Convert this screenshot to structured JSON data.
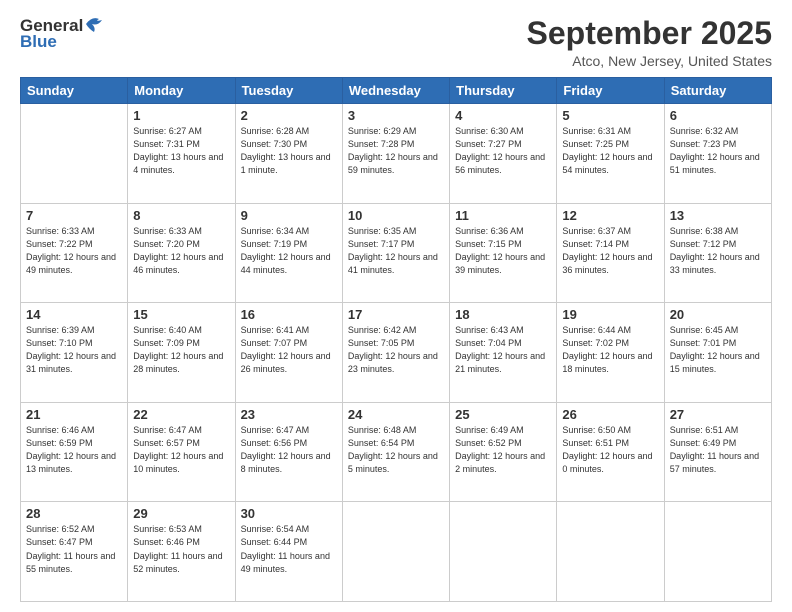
{
  "header": {
    "logo_general": "General",
    "logo_blue": "Blue",
    "title": "September 2025",
    "subtitle": "Atco, New Jersey, United States"
  },
  "calendar": {
    "days_of_week": [
      "Sunday",
      "Monday",
      "Tuesday",
      "Wednesday",
      "Thursday",
      "Friday",
      "Saturday"
    ],
    "weeks": [
      [
        {
          "day": "",
          "sunrise": "",
          "sunset": "",
          "daylight": ""
        },
        {
          "day": "1",
          "sunrise": "Sunrise: 6:27 AM",
          "sunset": "Sunset: 7:31 PM",
          "daylight": "Daylight: 13 hours and 4 minutes."
        },
        {
          "day": "2",
          "sunrise": "Sunrise: 6:28 AM",
          "sunset": "Sunset: 7:30 PM",
          "daylight": "Daylight: 13 hours and 1 minute."
        },
        {
          "day": "3",
          "sunrise": "Sunrise: 6:29 AM",
          "sunset": "Sunset: 7:28 PM",
          "daylight": "Daylight: 12 hours and 59 minutes."
        },
        {
          "day": "4",
          "sunrise": "Sunrise: 6:30 AM",
          "sunset": "Sunset: 7:27 PM",
          "daylight": "Daylight: 12 hours and 56 minutes."
        },
        {
          "day": "5",
          "sunrise": "Sunrise: 6:31 AM",
          "sunset": "Sunset: 7:25 PM",
          "daylight": "Daylight: 12 hours and 54 minutes."
        },
        {
          "day": "6",
          "sunrise": "Sunrise: 6:32 AM",
          "sunset": "Sunset: 7:23 PM",
          "daylight": "Daylight: 12 hours and 51 minutes."
        }
      ],
      [
        {
          "day": "7",
          "sunrise": "Sunrise: 6:33 AM",
          "sunset": "Sunset: 7:22 PM",
          "daylight": "Daylight: 12 hours and 49 minutes."
        },
        {
          "day": "8",
          "sunrise": "Sunrise: 6:33 AM",
          "sunset": "Sunset: 7:20 PM",
          "daylight": "Daylight: 12 hours and 46 minutes."
        },
        {
          "day": "9",
          "sunrise": "Sunrise: 6:34 AM",
          "sunset": "Sunset: 7:19 PM",
          "daylight": "Daylight: 12 hours and 44 minutes."
        },
        {
          "day": "10",
          "sunrise": "Sunrise: 6:35 AM",
          "sunset": "Sunset: 7:17 PM",
          "daylight": "Daylight: 12 hours and 41 minutes."
        },
        {
          "day": "11",
          "sunrise": "Sunrise: 6:36 AM",
          "sunset": "Sunset: 7:15 PM",
          "daylight": "Daylight: 12 hours and 39 minutes."
        },
        {
          "day": "12",
          "sunrise": "Sunrise: 6:37 AM",
          "sunset": "Sunset: 7:14 PM",
          "daylight": "Daylight: 12 hours and 36 minutes."
        },
        {
          "day": "13",
          "sunrise": "Sunrise: 6:38 AM",
          "sunset": "Sunset: 7:12 PM",
          "daylight": "Daylight: 12 hours and 33 minutes."
        }
      ],
      [
        {
          "day": "14",
          "sunrise": "Sunrise: 6:39 AM",
          "sunset": "Sunset: 7:10 PM",
          "daylight": "Daylight: 12 hours and 31 minutes."
        },
        {
          "day": "15",
          "sunrise": "Sunrise: 6:40 AM",
          "sunset": "Sunset: 7:09 PM",
          "daylight": "Daylight: 12 hours and 28 minutes."
        },
        {
          "day": "16",
          "sunrise": "Sunrise: 6:41 AM",
          "sunset": "Sunset: 7:07 PM",
          "daylight": "Daylight: 12 hours and 26 minutes."
        },
        {
          "day": "17",
          "sunrise": "Sunrise: 6:42 AM",
          "sunset": "Sunset: 7:05 PM",
          "daylight": "Daylight: 12 hours and 23 minutes."
        },
        {
          "day": "18",
          "sunrise": "Sunrise: 6:43 AM",
          "sunset": "Sunset: 7:04 PM",
          "daylight": "Daylight: 12 hours and 21 minutes."
        },
        {
          "day": "19",
          "sunrise": "Sunrise: 6:44 AM",
          "sunset": "Sunset: 7:02 PM",
          "daylight": "Daylight: 12 hours and 18 minutes."
        },
        {
          "day": "20",
          "sunrise": "Sunrise: 6:45 AM",
          "sunset": "Sunset: 7:01 PM",
          "daylight": "Daylight: 12 hours and 15 minutes."
        }
      ],
      [
        {
          "day": "21",
          "sunrise": "Sunrise: 6:46 AM",
          "sunset": "Sunset: 6:59 PM",
          "daylight": "Daylight: 12 hours and 13 minutes."
        },
        {
          "day": "22",
          "sunrise": "Sunrise: 6:47 AM",
          "sunset": "Sunset: 6:57 PM",
          "daylight": "Daylight: 12 hours and 10 minutes."
        },
        {
          "day": "23",
          "sunrise": "Sunrise: 6:47 AM",
          "sunset": "Sunset: 6:56 PM",
          "daylight": "Daylight: 12 hours and 8 minutes."
        },
        {
          "day": "24",
          "sunrise": "Sunrise: 6:48 AM",
          "sunset": "Sunset: 6:54 PM",
          "daylight": "Daylight: 12 hours and 5 minutes."
        },
        {
          "day": "25",
          "sunrise": "Sunrise: 6:49 AM",
          "sunset": "Sunset: 6:52 PM",
          "daylight": "Daylight: 12 hours and 2 minutes."
        },
        {
          "day": "26",
          "sunrise": "Sunrise: 6:50 AM",
          "sunset": "Sunset: 6:51 PM",
          "daylight": "Daylight: 12 hours and 0 minutes."
        },
        {
          "day": "27",
          "sunrise": "Sunrise: 6:51 AM",
          "sunset": "Sunset: 6:49 PM",
          "daylight": "Daylight: 11 hours and 57 minutes."
        }
      ],
      [
        {
          "day": "28",
          "sunrise": "Sunrise: 6:52 AM",
          "sunset": "Sunset: 6:47 PM",
          "daylight": "Daylight: 11 hours and 55 minutes."
        },
        {
          "day": "29",
          "sunrise": "Sunrise: 6:53 AM",
          "sunset": "Sunset: 6:46 PM",
          "daylight": "Daylight: 11 hours and 52 minutes."
        },
        {
          "day": "30",
          "sunrise": "Sunrise: 6:54 AM",
          "sunset": "Sunset: 6:44 PM",
          "daylight": "Daylight: 11 hours and 49 minutes."
        },
        {
          "day": "",
          "sunrise": "",
          "sunset": "",
          "daylight": ""
        },
        {
          "day": "",
          "sunrise": "",
          "sunset": "",
          "daylight": ""
        },
        {
          "day": "",
          "sunrise": "",
          "sunset": "",
          "daylight": ""
        },
        {
          "day": "",
          "sunrise": "",
          "sunset": "",
          "daylight": ""
        }
      ]
    ]
  }
}
